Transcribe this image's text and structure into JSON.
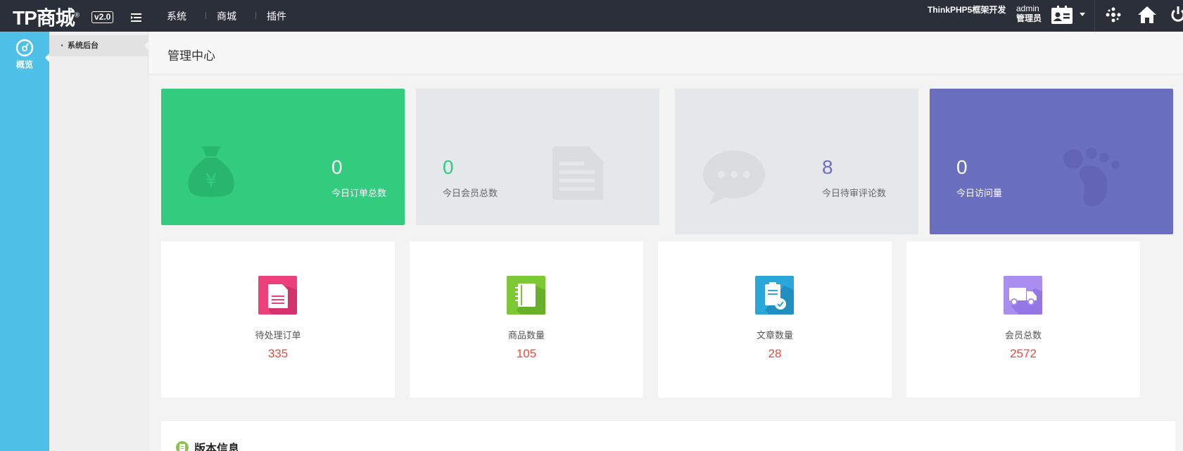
{
  "header": {
    "logo": "TP商城",
    "logo_mark": "®",
    "version": "v2.0",
    "nav": [
      "系统",
      "商城",
      "插件"
    ],
    "framework_text": "ThinkPHP5框架开发",
    "user": {
      "name": "admin",
      "role": "管理员"
    }
  },
  "sidebar": {
    "items": [
      {
        "label": "概览",
        "icon": "dashboard-icon"
      }
    ],
    "subitems": [
      {
        "label": "系统后台"
      }
    ]
  },
  "page": {
    "title": "管理中心"
  },
  "stats": [
    {
      "value": "0",
      "label": "今日订单总数",
      "icon": "money-bag-icon",
      "bg": "#33cc7e",
      "color": "#ffffff"
    },
    {
      "value": "0",
      "label": "今日会员总数",
      "icon": "document-icon",
      "bg": "#e4e8ea",
      "color": "#33cc7e"
    },
    {
      "value": "8",
      "label": "今日待审评论数",
      "icon": "chat-bubble-icon",
      "bg": "#e4e8ea",
      "color": "#6b6fc0"
    },
    {
      "value": "0",
      "label": "今日访问量",
      "icon": "footprint-icon",
      "bg": "#6b6fc0",
      "color": "#ffffff"
    }
  ],
  "cards": [
    {
      "label": "待处理订单",
      "value": "335",
      "icon": "order-icon",
      "color": "#ec407a"
    },
    {
      "label": "商品数量",
      "value": "105",
      "icon": "notebook-icon",
      "color": "#7cc935"
    },
    {
      "label": "文章数量",
      "value": "28",
      "icon": "clipboard-check-icon",
      "color": "#2aa6d9"
    },
    {
      "label": "会员总数",
      "value": "2572",
      "icon": "truck-icon",
      "color": "#a98ef0"
    }
  ],
  "version_panel": {
    "title": "版本信息"
  }
}
